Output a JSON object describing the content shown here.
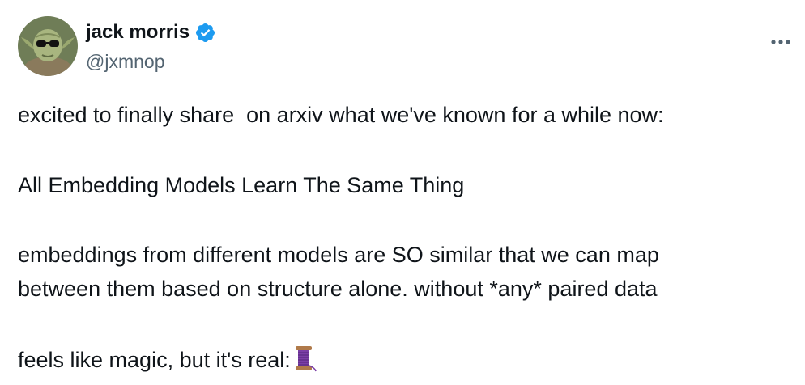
{
  "author": {
    "display_name": "jack morris",
    "handle": "@jxmnop",
    "avatar_icon": "yoda-avatar",
    "verified_icon": "verified-badge-icon",
    "verified_color": "#1d9bf0"
  },
  "actions": {
    "more_icon": "more-horizontal-icon"
  },
  "tweet": {
    "line_1": "excited to finally share  on arxiv what we've known for a while now:",
    "line_2": "All Embedding Models Learn The Same Thing",
    "line_3": "embeddings from different models are SO similar that we can map",
    "line_4": "between them based on structure alone. without *any* paired data",
    "line_5": "feels like magic, but it's real:",
    "line_5_emoji": "spool-of-thread-icon"
  },
  "colors": {
    "text_primary": "#0f1419",
    "text_secondary": "#536471",
    "accent": "#1d9bf0",
    "thread_purple": "#7b3fa6"
  }
}
